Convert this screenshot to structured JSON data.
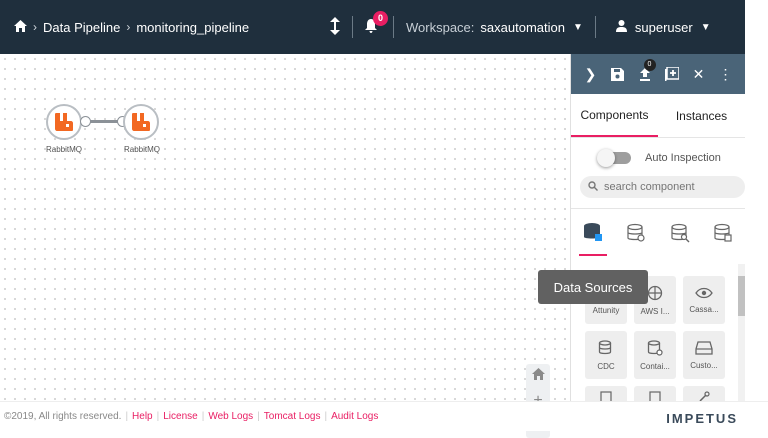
{
  "header": {
    "breadcrumbs": [
      "Data Pipeline",
      "monitoring_pipeline"
    ],
    "notification_count": "0",
    "workspace_label": "Workspace:",
    "workspace_value": "saxautomation",
    "user": "superuser"
  },
  "canvas": {
    "nodes": [
      {
        "label": "RabbitMQ"
      },
      {
        "label": "RabbitMQ"
      }
    ],
    "tooltip": "Data Sources"
  },
  "panel": {
    "upload_badge": "0",
    "tabs": [
      {
        "label": "Components",
        "active": true
      },
      {
        "label": "Instances",
        "active": false
      }
    ],
    "auto_inspection_label": "Auto Inspection",
    "search_placeholder": "search component",
    "components": [
      {
        "label": "Attunity"
      },
      {
        "label": "AWS I..."
      },
      {
        "label": "Cassa..."
      },
      {
        "label": "CDC"
      },
      {
        "label": "Contai..."
      },
      {
        "label": "Custo..."
      }
    ]
  },
  "footer": {
    "copyright": "©2019, All rights reserved.",
    "links": [
      "Help",
      "License",
      "Web Logs",
      "Tomcat Logs",
      "Audit Logs"
    ],
    "brand": "IMPETUS"
  },
  "colors": {
    "header_bg": "#1f2f3d",
    "panel_bar_bg": "#4a6478",
    "accent": "#e91e63",
    "rabbitmq": "#f26822"
  }
}
